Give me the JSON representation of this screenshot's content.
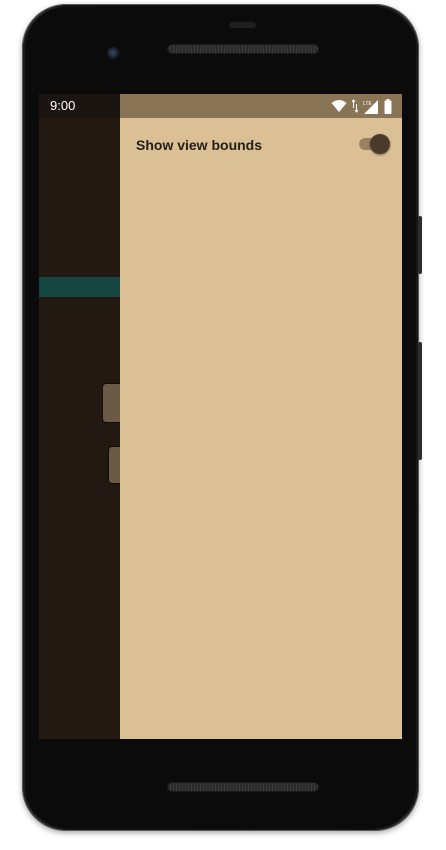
{
  "statusbar": {
    "time": "9:00",
    "icons": [
      "wifi-icon",
      "data-arrows-icon",
      "cell-signal-lte-icon",
      "battery-icon"
    ],
    "network_label": "LTE"
  },
  "drawer": {
    "settings": [
      {
        "label": "Show view bounds",
        "enabled": true
      }
    ]
  },
  "colors": {
    "drawer_background": "#dbbf95",
    "drawer_statusbar": "#8a7456",
    "app_background": "#221912",
    "app_accent": "#154641",
    "switch_thumb": "#4a3a2c",
    "switch_track": "#9c8263"
  }
}
